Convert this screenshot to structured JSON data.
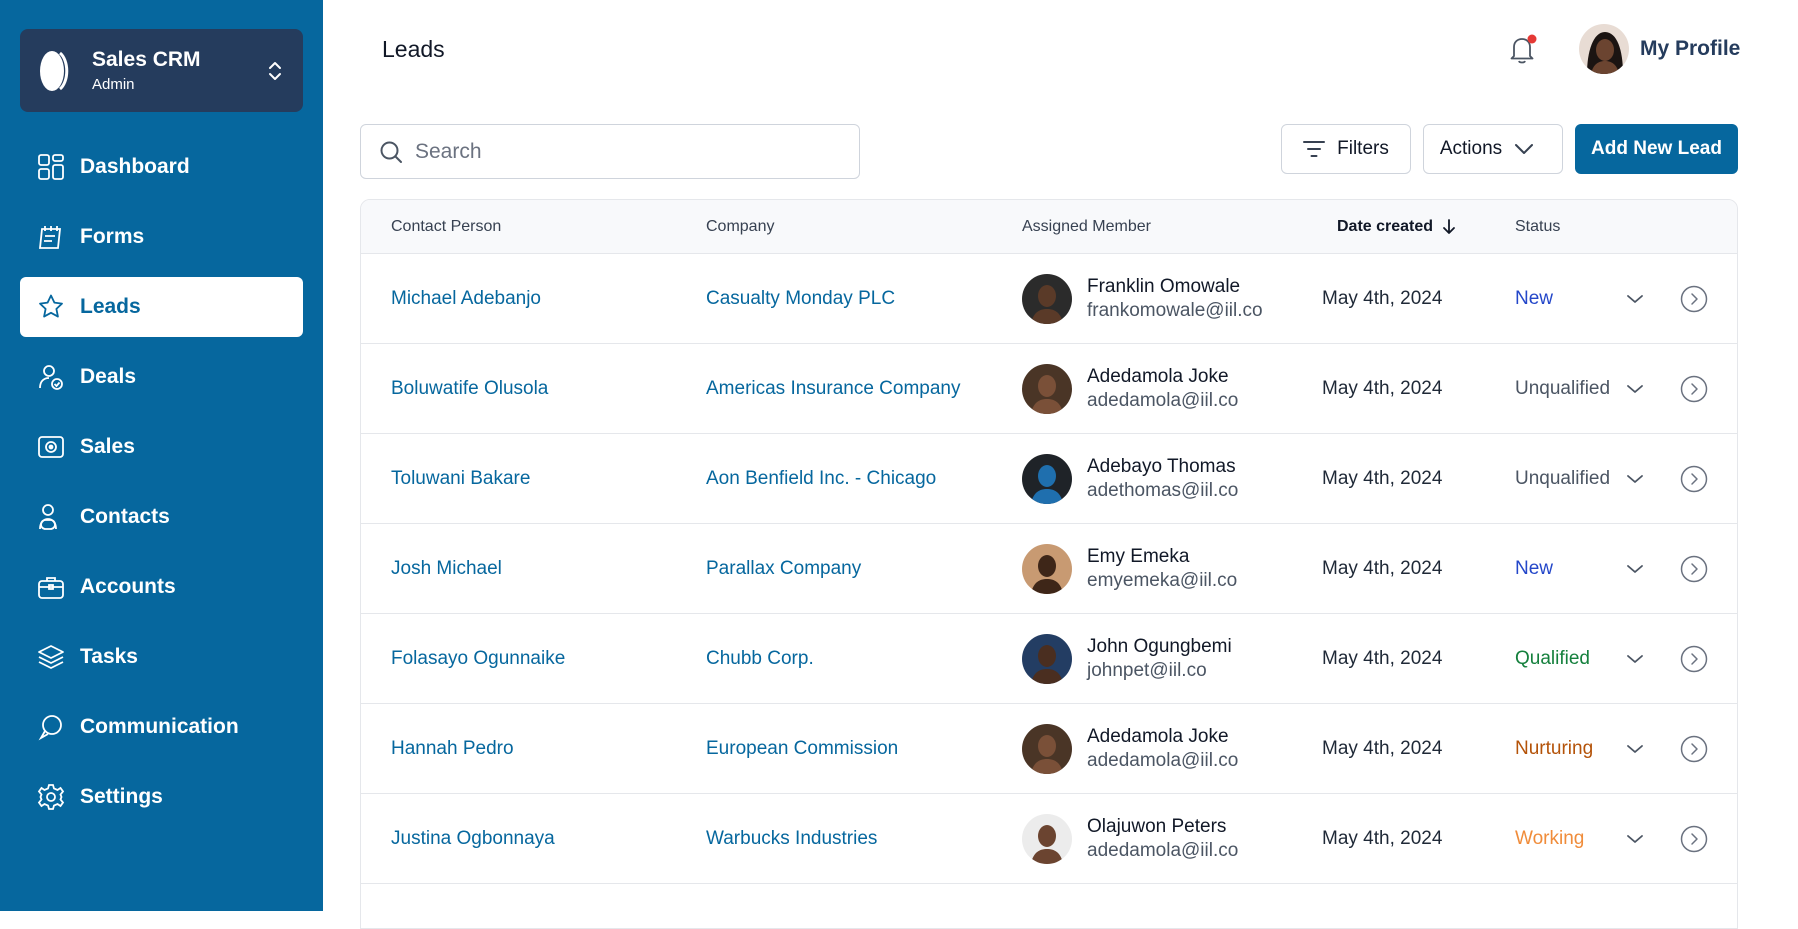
{
  "workspace": {
    "title": "Sales CRM",
    "role": "Admin"
  },
  "sidebar": {
    "items": [
      {
        "label": "Dashboard",
        "icon": "dashboard-icon"
      },
      {
        "label": "Forms",
        "icon": "forms-icon"
      },
      {
        "label": "Leads",
        "icon": "star-icon",
        "active": true
      },
      {
        "label": "Deals",
        "icon": "deals-icon"
      },
      {
        "label": "Sales",
        "icon": "sales-icon"
      },
      {
        "label": "Contacts",
        "icon": "contacts-icon"
      },
      {
        "label": "Accounts",
        "icon": "briefcase-icon"
      },
      {
        "label": "Tasks",
        "icon": "layers-icon"
      },
      {
        "label": "Communication",
        "icon": "chat-icon"
      },
      {
        "label": "Settings",
        "icon": "gear-icon"
      }
    ]
  },
  "header": {
    "title": "Leads",
    "profile_label": "My Profile",
    "notification_dot_color": "#e53935"
  },
  "toolbar": {
    "search_placeholder": "Search",
    "filters_label": "Filters",
    "actions_label": "Actions",
    "add_label": "Add New Lead"
  },
  "table": {
    "columns": {
      "contact": "Contact Person",
      "company": "Company",
      "member": "Assigned Member",
      "date": "Date created",
      "status": "Status"
    },
    "rows": [
      {
        "contact": "Michael Adebanjo",
        "company": "Casualty Monday PLC",
        "member_name": "Franklin Omowale",
        "member_email": "frankomowale@iil.co",
        "date": "May 4th, 2024",
        "status": "New",
        "status_class": "st-new",
        "avatar_bg": "#2b2b2b"
      },
      {
        "contact": "Boluwatife Olusola",
        "company": "Americas Insurance Company",
        "member_name": "Adedamola Joke",
        "member_email": "adedamola@iil.co",
        "date": "May 4th, 2024",
        "status": "Unqualified",
        "status_class": "st-unq",
        "avatar_bg": "#4a3526"
      },
      {
        "contact": "Toluwani Bakare",
        "company": "Aon Benfield Inc. - Chicago",
        "member_name": "Adebayo Thomas",
        "member_email": "adethomas@iil.co",
        "date": "May 4th, 2024",
        "status": "Unqualified",
        "status_class": "st-unq",
        "avatar_bg": "#1f2328"
      },
      {
        "contact": "Josh Michael",
        "company": "Parallax Company",
        "member_name": "Emy Emeka",
        "member_email": "emyemeka@iil.co",
        "date": "May 4th, 2024",
        "status": "New",
        "status_class": "st-new",
        "avatar_bg": "#c89a72"
      },
      {
        "contact": "Folasayo Ogunnaike",
        "company": "Chubb Corp.",
        "member_name": "John Ogungbemi",
        "member_email": "johnpet@iil.co",
        "date": "May 4th, 2024",
        "status": "Qualified",
        "status_class": "st-qual",
        "avatar_bg": "#233d63"
      },
      {
        "contact": "Hannah Pedro",
        "company": "European Commission",
        "member_name": "Adedamola Joke",
        "member_email": "adedamola@iil.co",
        "date": "May 4th, 2024",
        "status": "Nurturing",
        "status_class": "st-nurt",
        "avatar_bg": "#4a3526"
      },
      {
        "contact": "Justina Ogbonnaya",
        "company": "Warbucks Industries",
        "member_name": "Olajuwon Peters",
        "member_email": "adedamola@iil.co",
        "date": "May 4th, 2024",
        "status": "Working",
        "status_class": "st-work",
        "avatar_bg": "#ececec"
      }
    ]
  }
}
